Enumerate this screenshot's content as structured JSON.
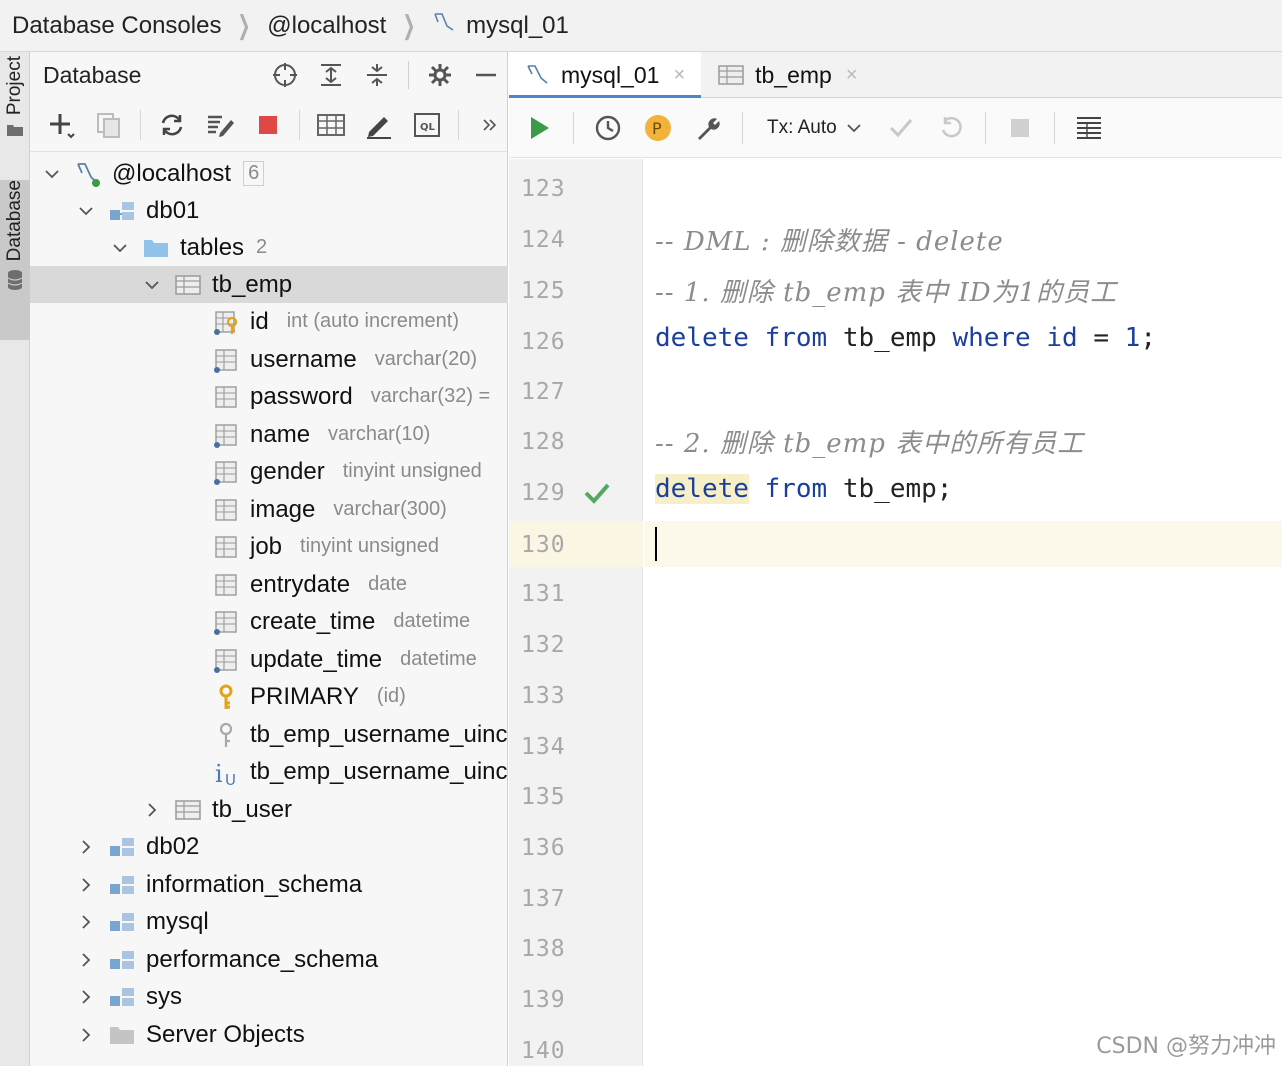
{
  "breadcrumb": {
    "items": [
      "Database Consoles",
      "@localhost",
      "mysql_01"
    ]
  },
  "left_strip": {
    "project_label": "Project",
    "database_label": "Database"
  },
  "db_panel": {
    "title": "Database"
  },
  "tree": {
    "localhost": {
      "label": "@localhost",
      "count": "6"
    },
    "db01": {
      "label": "db01"
    },
    "tables": {
      "label": "tables",
      "count": "2"
    },
    "tb_emp": {
      "label": "tb_emp"
    },
    "columns": [
      {
        "name": "id",
        "type": "int (auto increment)"
      },
      {
        "name": "username",
        "type": "varchar(20)"
      },
      {
        "name": "password",
        "type": "varchar(32) ="
      },
      {
        "name": "name",
        "type": "varchar(10)"
      },
      {
        "name": "gender",
        "type": "tinyint unsigned"
      },
      {
        "name": "image",
        "type": "varchar(300)"
      },
      {
        "name": "job",
        "type": "tinyint unsigned"
      },
      {
        "name": "entrydate",
        "type": "date"
      },
      {
        "name": "create_time",
        "type": "datetime"
      },
      {
        "name": "update_time",
        "type": "datetime"
      }
    ],
    "primary": {
      "name": "PRIMARY",
      "type": "(id)"
    },
    "index1": {
      "name": "tb_emp_username_uinc"
    },
    "index2": {
      "name": "tb_emp_username_uinc"
    },
    "tb_user": {
      "label": "tb_user"
    },
    "schemas": [
      "db02",
      "information_schema",
      "mysql",
      "performance_schema",
      "sys"
    ],
    "server_objects": "Server Objects"
  },
  "editor": {
    "tabs": [
      {
        "label": "mysql_01",
        "close": "×"
      },
      {
        "label": "tb_emp",
        "close": "×"
      }
    ],
    "tx_mode": "Tx: Auto",
    "profile_badge": "P",
    "line_numbers": [
      "123",
      "124",
      "125",
      "126",
      "127",
      "128",
      "129",
      "130",
      "131",
      "132",
      "133",
      "134",
      "135",
      "136",
      "137",
      "138",
      "139",
      "140"
    ],
    "code": {
      "l124": "-- DML : 删除数据 - delete",
      "l125": "-- 1. 删除 tb_emp 表中 ID为1的员工",
      "l126_kw1": "delete",
      "l126_kw2": "from",
      "l126_table": "tb_emp",
      "l126_kw3": "where",
      "l126_col": "id",
      "l126_op": "=",
      "l126_val": "1",
      "l126_end": ";",
      "l128": "-- 2. 删除 tb_emp 表中的所有员工",
      "l129_kw1": "delete",
      "l129_kw2": "from",
      "l129_table": "tb_emp",
      "l129_end": ";"
    }
  },
  "watermark": "CSDN @努力冲冲",
  "colors": {
    "keyword": "#1b3f9e",
    "comment": "#8c8c8c",
    "accent_tab": "#4a86c8",
    "run_green": "#3c9a48",
    "stop_red": "#e04848"
  }
}
